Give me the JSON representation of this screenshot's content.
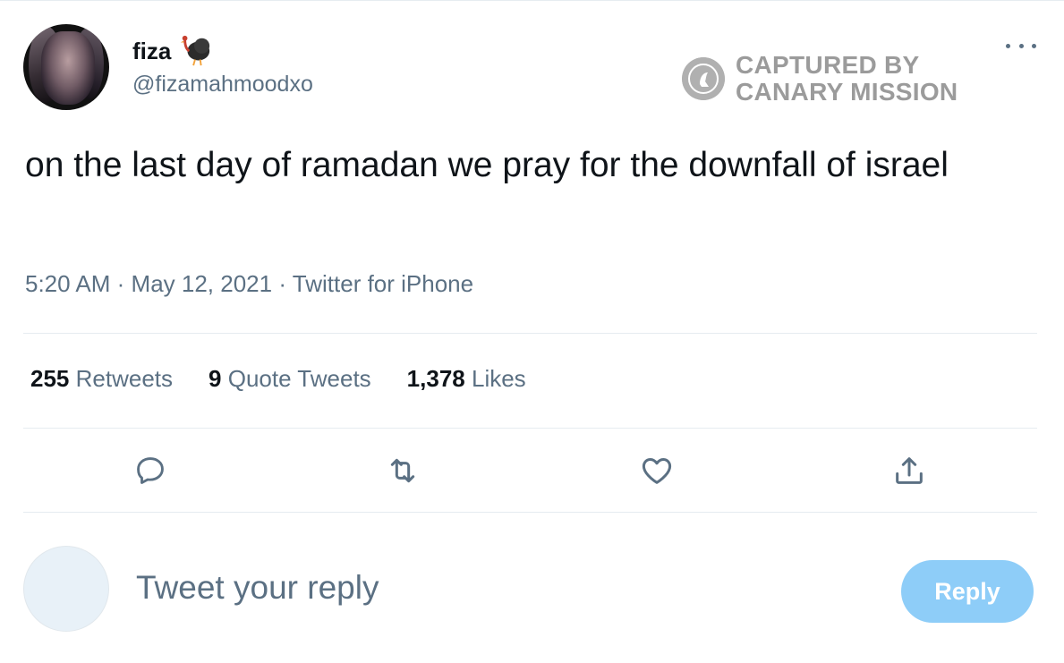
{
  "tweet": {
    "author": {
      "display_name": "fiza",
      "display_name_emoji": "turkey-icon",
      "handle": "@fizamahmoodxo"
    },
    "text": "on the last day of ramadan we pray for the downfall of israel",
    "meta": {
      "time": "5:20 AM",
      "separator": "·",
      "date": "May 12, 2021",
      "source": "Twitter for iPhone"
    },
    "stats": [
      {
        "count": "255",
        "label": "Retweets"
      },
      {
        "count": "9",
        "label": "Quote Tweets"
      },
      {
        "count": "1,378",
        "label": "Likes"
      }
    ],
    "actions": [
      {
        "name": "reply",
        "icon": "reply-icon"
      },
      {
        "name": "retweet",
        "icon": "retweet-icon"
      },
      {
        "name": "like",
        "icon": "heart-icon"
      },
      {
        "name": "share",
        "icon": "share-icon"
      }
    ]
  },
  "watermark": {
    "line1": "CAPTURED BY",
    "line2": "CANARY MISSION"
  },
  "reply_box": {
    "placeholder": "Tweet your reply",
    "button_label": "Reply"
  },
  "colors": {
    "text_primary": "#0f1419",
    "text_secondary": "#5b7083",
    "divider": "#e6ecf0",
    "reply_button_disabled": "#8ecdf8",
    "watermark": "#9b9b9b"
  }
}
